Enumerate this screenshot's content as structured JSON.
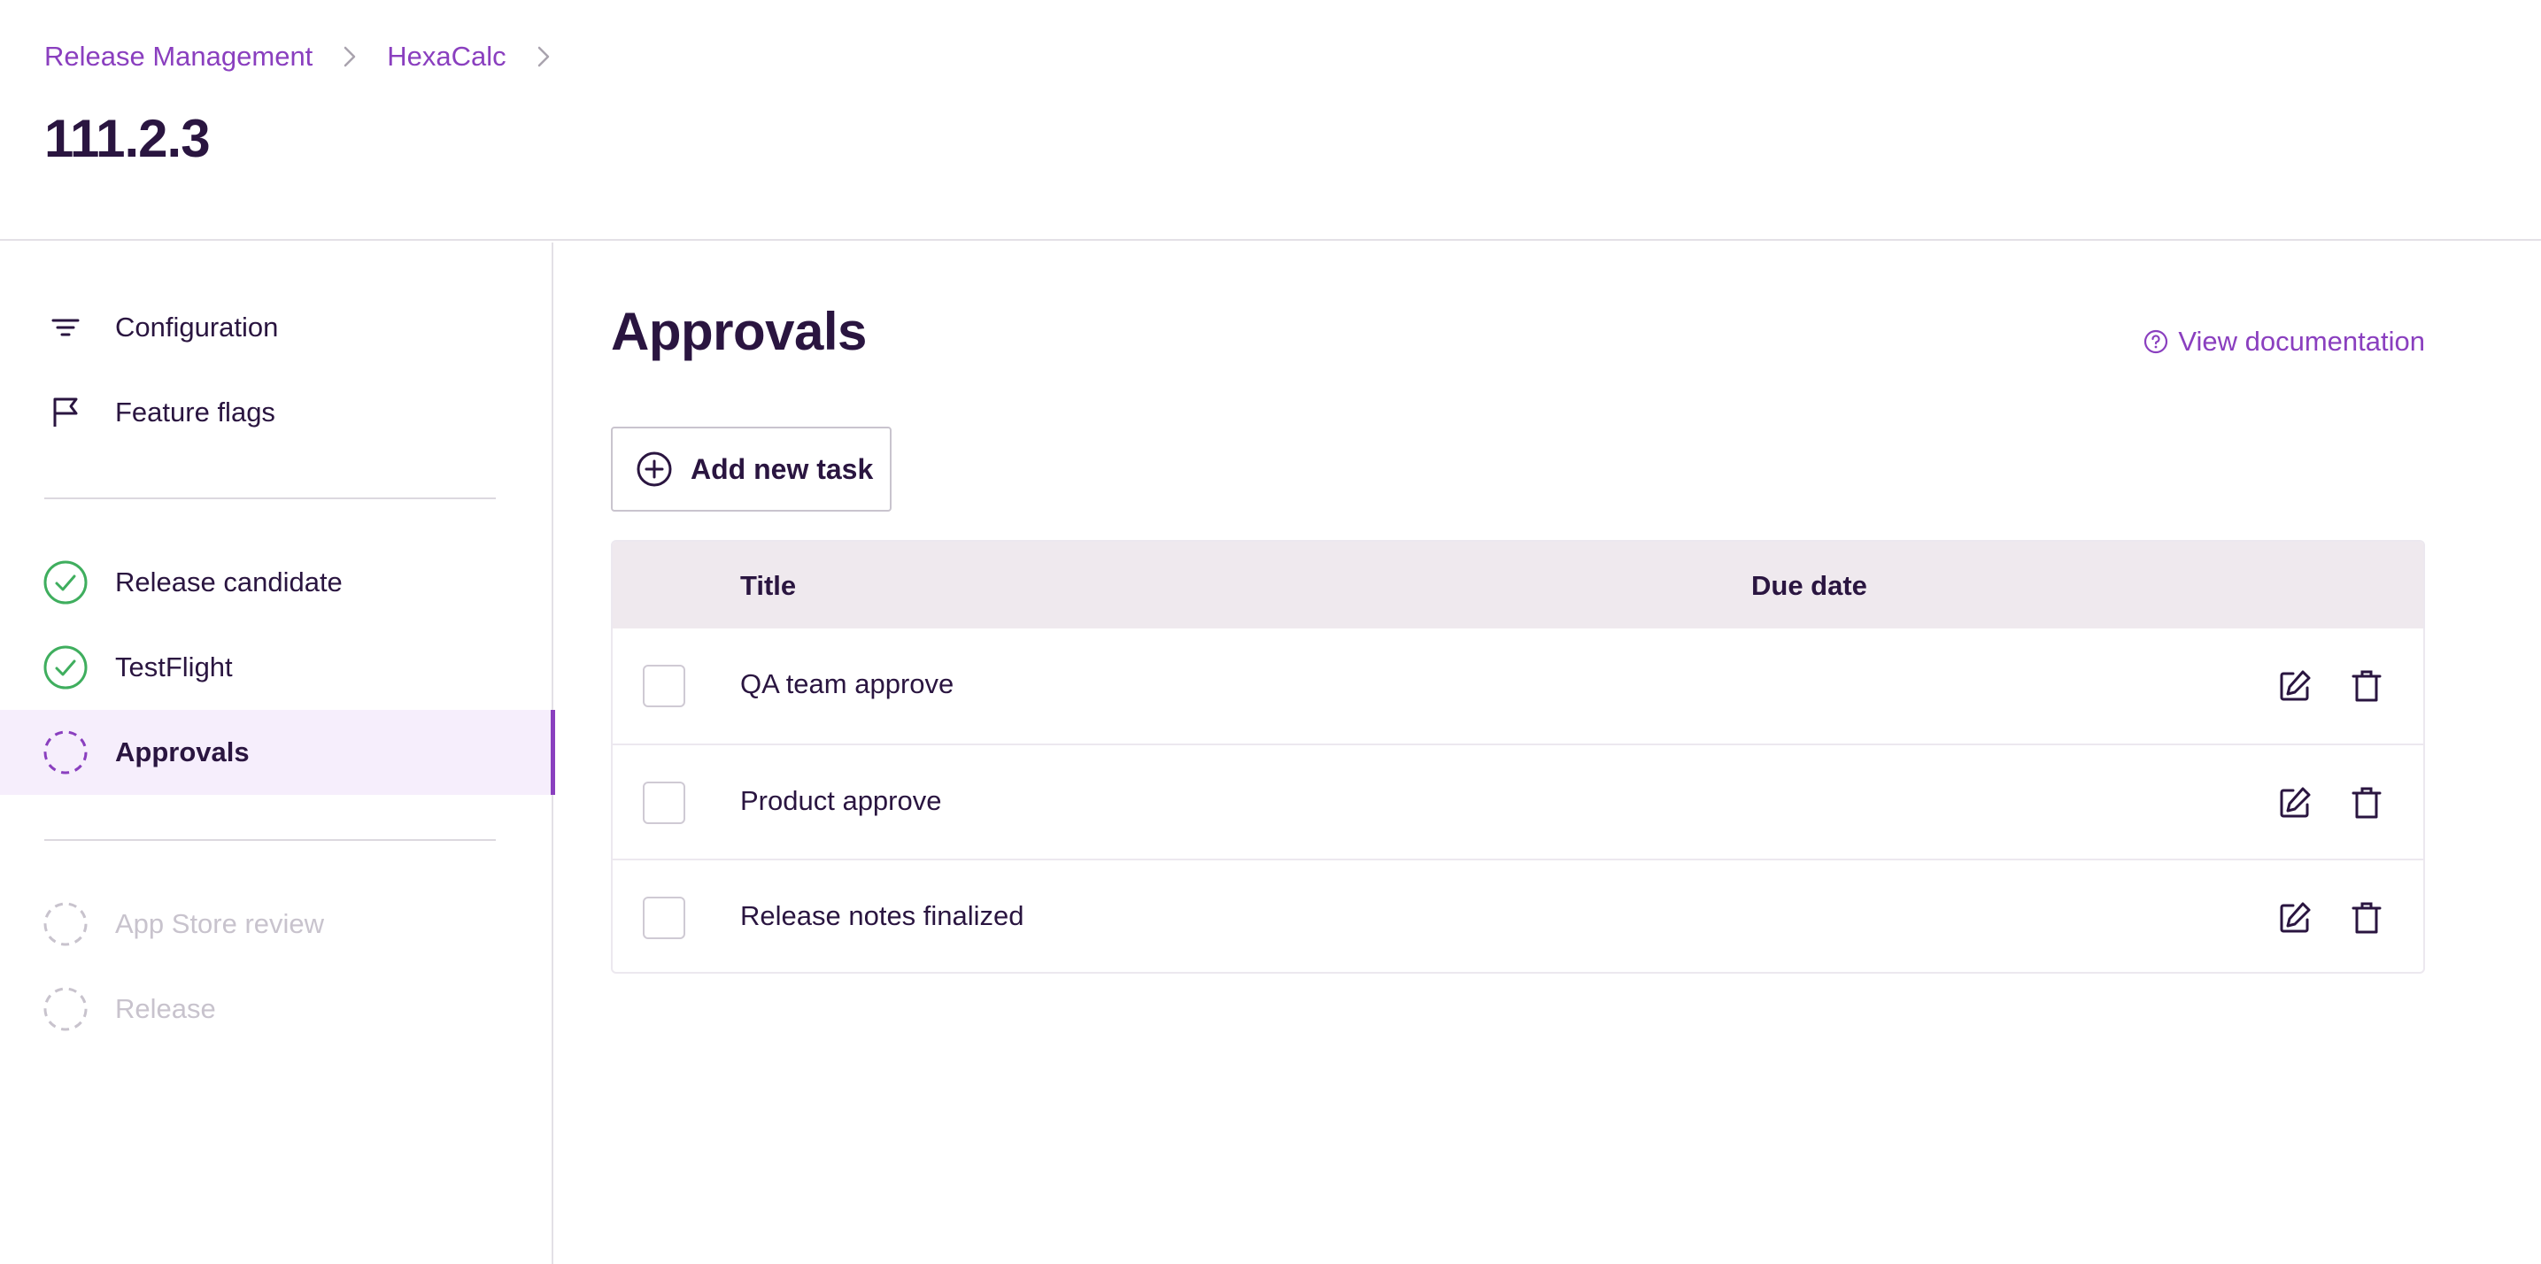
{
  "breadcrumb": {
    "items": [
      {
        "label": "Release Management"
      },
      {
        "label": "HexaCalc"
      }
    ]
  },
  "page": {
    "title": "111.2.3"
  },
  "sidebar": {
    "nav": [
      {
        "label": "Configuration",
        "icon": "filter-lines-icon"
      },
      {
        "label": "Feature flags",
        "icon": "flag-icon"
      }
    ],
    "steps": [
      {
        "label": "Release candidate",
        "status": "completed"
      },
      {
        "label": "TestFlight",
        "status": "completed"
      },
      {
        "label": "Approvals",
        "status": "current"
      },
      {
        "label": "App Store review",
        "status": "pending"
      },
      {
        "label": "Release",
        "status": "pending"
      }
    ]
  },
  "main": {
    "title": "Approvals",
    "doc_link": "View documentation",
    "add_button": "Add new task",
    "table": {
      "columns": [
        "Title",
        "Due date"
      ],
      "rows": [
        {
          "title": "QA team approve",
          "due_date": "",
          "checked": false
        },
        {
          "title": "Product approve",
          "due_date": "",
          "checked": false
        },
        {
          "title": "Release notes finalized",
          "due_date": "",
          "checked": false
        }
      ]
    }
  },
  "colors": {
    "accent": "#8a3fbf",
    "text": "#2a1540",
    "success": "#3fae5e",
    "disabled": "#c8c3cd",
    "active_bg": "#f6eefc",
    "table_header_bg": "#efe9ee"
  }
}
